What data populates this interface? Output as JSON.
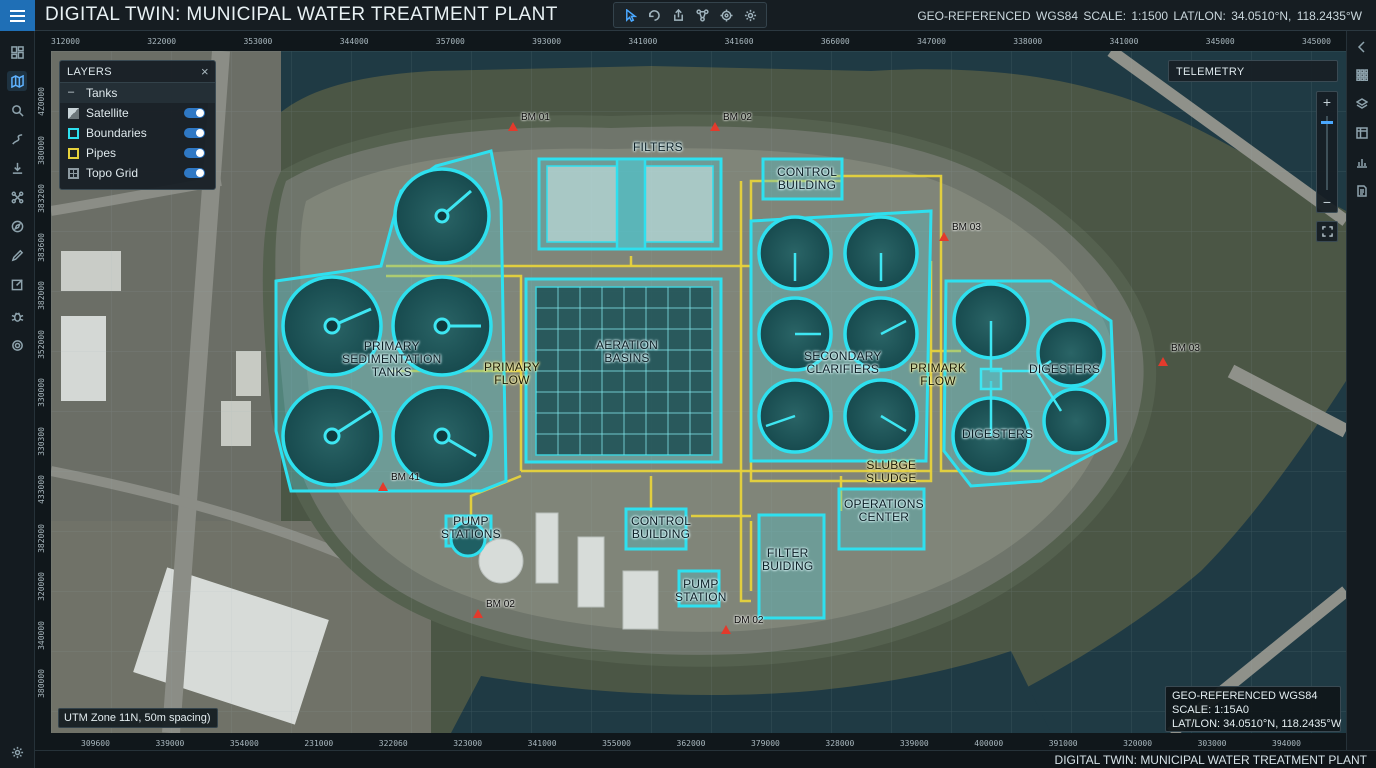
{
  "app": {
    "title": "DIGITAL TWIN: MUNICIPAL WATER TREATMENT PLANT",
    "georef_bar": "GEO-REFERENCED WGS84   SCALE: 1:1500   LAT/LON: 34.0510°N, 118.2435°W",
    "footer_title": "DIGITAL TWIN: MUNICIPAL WATER TREATMENT PLANT"
  },
  "toolbar": {
    "tools": [
      "select-icon",
      "rotate-icon",
      "share-icon",
      "network-icon",
      "target-icon",
      "gear-icon"
    ]
  },
  "rail": {
    "icons": [
      "dashboard-icon",
      "map-icon",
      "search-icon",
      "route-icon",
      "download-icon",
      "network-icon",
      "compass-icon",
      "pen-icon",
      "edit-icon",
      "bug-icon",
      "gear-icon"
    ],
    "bottom_icon": "settings-icon"
  },
  "right_rail": {
    "icons": [
      "collapse-icon",
      "grid-icon",
      "layers-icon",
      "table-icon",
      "chart-icon",
      "document-icon"
    ]
  },
  "rulers": {
    "top": [
      "312000",
      "322000",
      "353000",
      "344000",
      "357000",
      "393000",
      "341000",
      "341600",
      "366000",
      "347000",
      "338000",
      "341000",
      "345000",
      "345000"
    ],
    "bottom": [
      "309600",
      "339000",
      "354000",
      "231000",
      "322060",
      "323000",
      "341000",
      "355000",
      "362000",
      "379000",
      "328000",
      "339000",
      "400000",
      "391000",
      "320000",
      "303000",
      "394000"
    ],
    "left": [
      "4Z0000",
      "380000",
      "383200",
      "383600",
      "382000",
      "352000",
      "330000",
      "330300",
      "433000",
      "382000",
      "320000",
      "340000",
      "380000"
    ]
  },
  "layers_panel": {
    "title": "LAYERS",
    "close": "×",
    "group": "Tanks",
    "items": [
      {
        "label": "Satellite",
        "enabled": true,
        "swatch": "#c9d4d8"
      },
      {
        "label": "Boundaries",
        "enabled": true,
        "swatch": "#2ee0ef"
      },
      {
        "label": "Pipes",
        "enabled": true,
        "swatch": "#e6d23c"
      },
      {
        "label": "Topo Grid",
        "enabled": true,
        "swatch": "#8d9aa1"
      }
    ]
  },
  "telemetry": {
    "title": "TELEMETRY"
  },
  "zoom": {
    "plus": "+",
    "minus": "−",
    "level": 0.93
  },
  "map": {
    "labels": {
      "filters": "FILTERS",
      "control_top": "CONTROL\nBUILDING",
      "aeration": "AERATION\nBASINS",
      "primary_sed": "PRIMARY\nSEDIMENTATION\nTANKS",
      "primary_flow_left": "PRIMARY\nFLOW",
      "secondary": "SECONDARY\nCLARIFIERS",
      "primary_flow_right": "PRIMARK\nFLOW",
      "digesters_top": "DIGESTERS",
      "digesters_bottom": "DIGESTERS",
      "sludge": "SLUBGE\nSLUDGE",
      "pump_stations": "PUMP\nSTATIONS",
      "control_bottom": "CONTROL\nBUILDING",
      "pump_station": "PUMP\nSTATION",
      "filter_building": "FILTER\nBUIDING",
      "operations": "OPERATIONS\nCENTER"
    },
    "benchmarks": {
      "bm01": "BM 01",
      "bm02_top": "BM 02",
      "bm03_right": "BM 03",
      "bm03_far": "BM 03",
      "bm41": "BM 41",
      "bm02_bottom_left": "BM 02",
      "bm02_bottom": "DM 02"
    },
    "colors": {
      "boundary": "#2ee0ef",
      "pipe": "#e6d23c",
      "benchmark": "#e33a2c",
      "water": "#1f3a44"
    }
  },
  "utm_label": "UTM Zone 11N, 50m spacing)",
  "georef_box": {
    "line1": "GEO-REFERENCED WGS84",
    "line2": "SCALE: 1:15A0",
    "line3": "LAT/LON: 34.0510°N, 118.2435°W"
  }
}
